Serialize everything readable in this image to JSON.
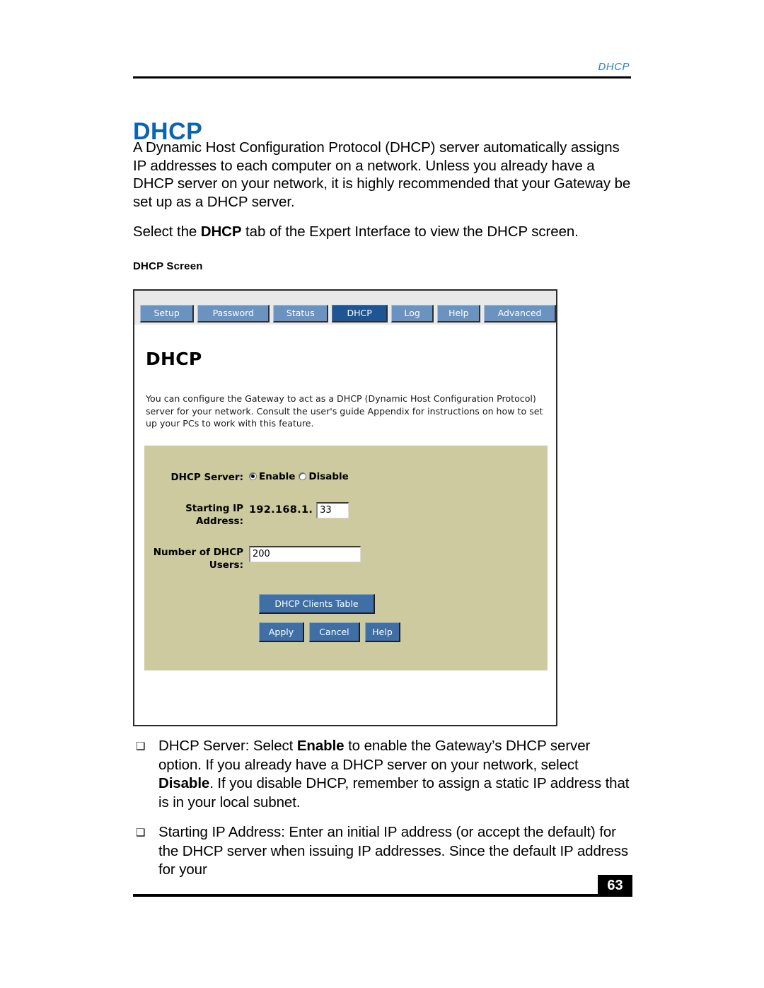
{
  "header": {
    "running_head": "DHCP"
  },
  "page_title": "DHCP",
  "paragraphs": {
    "intro": "A Dynamic Host Configuration Protocol (DHCP) server automatically assigns IP addresses to each computer on a network. Unless you already have a DHCP server on your network, it is highly recommended that your Gateway be set up as a DHCP server.",
    "select_prefix": "Select the ",
    "select_bold": "DHCP",
    "select_suffix": " tab of the Expert Interface to view the DHCP screen."
  },
  "figure": {
    "caption": "DHCP Screen",
    "tabs": [
      {
        "label": "Setup",
        "active": false
      },
      {
        "label": "Password",
        "active": false
      },
      {
        "label": "Status",
        "active": false
      },
      {
        "label": "DHCP",
        "active": true
      },
      {
        "label": "Log",
        "active": false
      },
      {
        "label": "Help",
        "active": false
      },
      {
        "label": "Advanced",
        "active": false
      }
    ],
    "screen_heading": "DHCP",
    "screen_description": "You can configure the Gateway to act as a DHCP (Dynamic Host Configuration Protocol) server for your network. Consult the user's guide Appendix for instructions on how to set up your PCs to work with this feature.",
    "form": {
      "dhcp_server_label": "DHCP Server:",
      "enable_label": "Enable",
      "disable_label": "Disable",
      "dhcp_server_value": "Enable",
      "starting_ip_label": "Starting IP Address:",
      "starting_ip_prefix": "192.168.1.",
      "starting_ip_value": "33",
      "number_users_label": "Number of DHCP Users:",
      "number_users_value": "200",
      "clients_table_button": "DHCP Clients Table",
      "apply_button": "Apply",
      "cancel_button": "Cancel",
      "help_button": "Help"
    },
    "colors": {
      "tab_inactive": "#6b93c0",
      "tab_active": "#1f5592",
      "panel_background": "#ccca9e",
      "button": "#3f6fa5"
    }
  },
  "bullets": [
    {
      "marker": "❑",
      "lead": "DHCP Server:  Select ",
      "bold1": "Enable",
      "mid1": " to enable the Gateway’s DHCP server option. If you already have a DHCP server on your network, select ",
      "bold2": "Disable",
      "tail": ". If you disable DHCP, remember to assign a static IP address that is in your local subnet."
    },
    {
      "marker": "❑",
      "text": "Starting IP Address:  Enter an initial IP address (or accept the default) for the DHCP server when issuing IP addresses. Since the default IP address for your"
    }
  ],
  "footer": {
    "page_number": "63"
  }
}
